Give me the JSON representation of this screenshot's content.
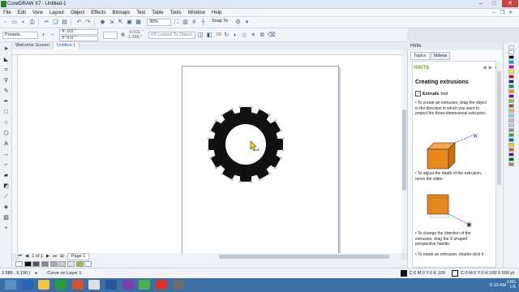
{
  "window": {
    "title": "CorelDRAW X7 - Untitled-1",
    "minimize": "–",
    "maximize": "□",
    "close": "✕"
  },
  "menu": {
    "items": [
      "File",
      "Edit",
      "View",
      "Layout",
      "Object",
      "Effects",
      "Bitmaps",
      "Text",
      "Table",
      "Tools",
      "Window",
      "Help"
    ]
  },
  "standard_toolbar": {
    "zoom": "30%",
    "snap": "Snap To"
  },
  "property_bar": {
    "preset": "Presets...",
    "x": "X: 0.0 \"",
    "y": "Y: 0.0 \"",
    "depth1": "-0.011 \"",
    "depth2": "1.396 \"",
    "vp": "VP Locked To Object",
    "steps": "20"
  },
  "doc_tabs": [
    "Welcome Screen",
    "Untitled-1"
  ],
  "page_nav": {
    "page_count": "1 of 1",
    "page_tab": "Page 1"
  },
  "docker": {
    "title": "Hints",
    "tabs": [
      "Topics",
      "Videos"
    ],
    "header": "HINTS",
    "heading": "Creating extrusions",
    "tool": "Extrude",
    "tool_suffix": "tool",
    "hint1": "• To create an extrusion, drag the object in the direction in which you want to project the three-dimensional extrusion.",
    "hint2": "• To adjust the depth of the extrusion, move the slider.",
    "hint3": "• To change the direction of the extrusion, drag the X-shaped perspective handle.",
    "hint4": "• To rotate an extrusion, double-click it"
  },
  "status": {
    "coords": "2.586 , 6.190 )",
    "object": "Curve on Layer 1",
    "fill": "C:0 M:0 Y:0 K:100",
    "outline": "C:0 M:0 Y:0 K:100  0.500 pt"
  },
  "tray": {
    "lang": "ENG",
    "region": "US",
    "time": "5:10 AM"
  },
  "colors": {
    "accent": "#6fa32b",
    "selection": "#1a56a0",
    "taskbar": "#3c6fa5",
    "close": "#c9463d"
  }
}
